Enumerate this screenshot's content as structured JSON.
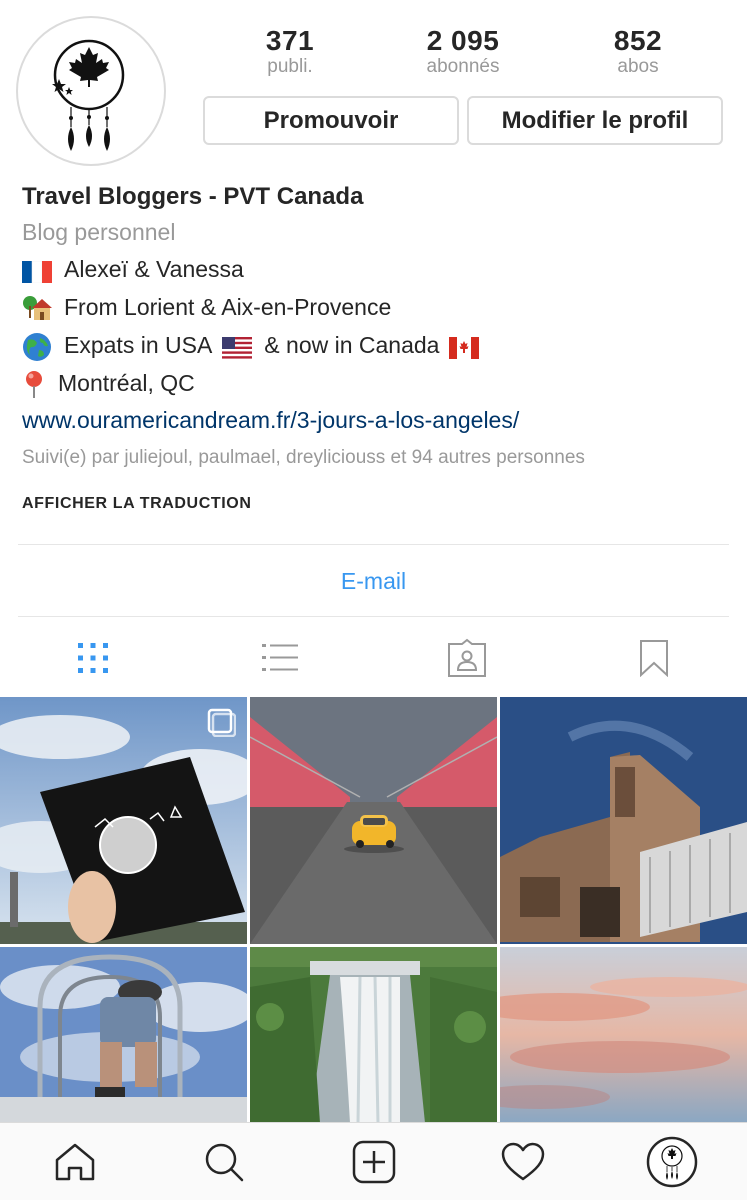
{
  "profile": {
    "stats": [
      {
        "value": "371",
        "label": "publi."
      },
      {
        "value": "2 095",
        "label": "abonnés"
      },
      {
        "value": "852",
        "label": "abos"
      }
    ],
    "promote_label": "Promouvoir",
    "edit_label": "Modifier le profil"
  },
  "bio": {
    "name": "Travel Bloggers - PVT Canada",
    "category": "Blog personnel",
    "lines": [
      {
        "icon": "france-flag-icon",
        "text": "Alexeï & Vanessa"
      },
      {
        "icon": "house-icon",
        "text": "From Lorient & Aix-en-Provence"
      },
      {
        "icon": "globe-icon",
        "text": "Expats in USA"
      },
      {
        "icon": "pin-icon",
        "text": "Montréal, QC"
      }
    ],
    "expats_suffix": "& now in Canada",
    "link": "www.ouramericandream.fr/3-jours-a-los-angeles/",
    "followed_by": "Suivi(e) par juliejoul, paulmael, dreyliciouss et 94 autres personnes",
    "translate": "AFFICHER LA TRADUCTION"
  },
  "contact": {
    "email_label": "E-mail"
  },
  "tabs": [
    {
      "icon": "grid-icon",
      "active": true
    },
    {
      "icon": "list-icon",
      "active": false
    },
    {
      "icon": "tagged-icon",
      "active": false
    },
    {
      "icon": "bookmark-icon",
      "active": false
    }
  ],
  "nav": [
    {
      "icon": "home-icon"
    },
    {
      "icon": "search-icon"
    },
    {
      "icon": "add-post-icon"
    },
    {
      "icon": "heart-icon"
    },
    {
      "icon": "profile-avatar-icon"
    }
  ],
  "colors": {
    "accent": "#3897f0",
    "link": "#003569",
    "muted": "#999999",
    "border": "#dbdbdb"
  }
}
